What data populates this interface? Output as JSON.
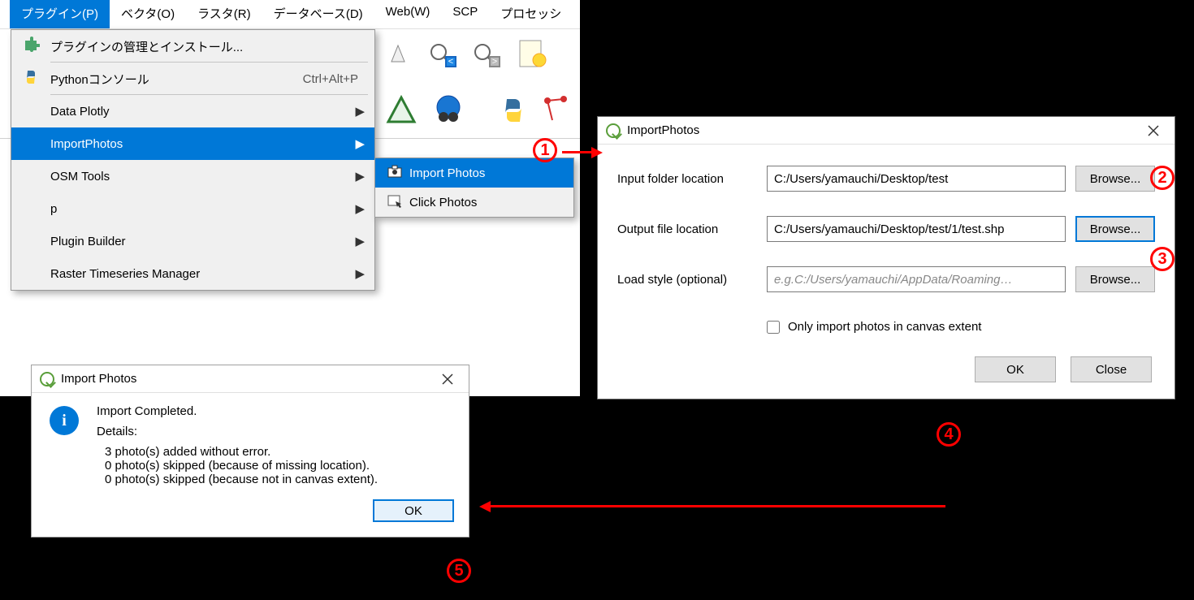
{
  "menubar": {
    "plugin": "プラグイン(P)",
    "vector": "ベクタ(O)",
    "raster": "ラスタ(R)",
    "database": "データベース(D)",
    "web": "Web(W)",
    "scp": "SCP",
    "processing": "プロセッシ"
  },
  "plugin_menu": {
    "manage": "プラグインの管理とインストール...",
    "python": "Pythonコンソール",
    "python_shortcut": "Ctrl+Alt+P",
    "dataplotly": "Data Plotly",
    "importphotos": "ImportPhotos",
    "osm": "OSM Tools",
    "p": "p",
    "builder": "Plugin Builder",
    "rts": "Raster Timeseries Manager"
  },
  "submenu": {
    "import": "Import Photos",
    "click": "Click Photos"
  },
  "import_dialog": {
    "title": "ImportPhotos",
    "input_label": "Input folder location",
    "input_value": "C:/Users/yamauchi/Desktop/test",
    "output_label": "Output file location",
    "output_value": "C:/Users/yamauchi/Desktop/test/1/test.shp",
    "style_label": "Load style (optional)",
    "style_placeholder": "e.g.C:/Users/yamauchi/AppData/Roaming…",
    "browse": "Browse...",
    "only_extent": "Only import photos in canvas extent",
    "ok": "OK",
    "close": "Close"
  },
  "result_dialog": {
    "title": "Import Photos",
    "completed": "Import Completed.",
    "details_hdr": "Details:",
    "line1": "3 photo(s) added without error.",
    "line2": "0 photo(s) skipped (because of missing location).",
    "line3": "0 photo(s) skipped (because not in canvas extent).",
    "ok": "OK"
  },
  "annotations": {
    "a1": "1",
    "a2": "2",
    "a3": "3",
    "a4": "4",
    "a5": "5"
  }
}
